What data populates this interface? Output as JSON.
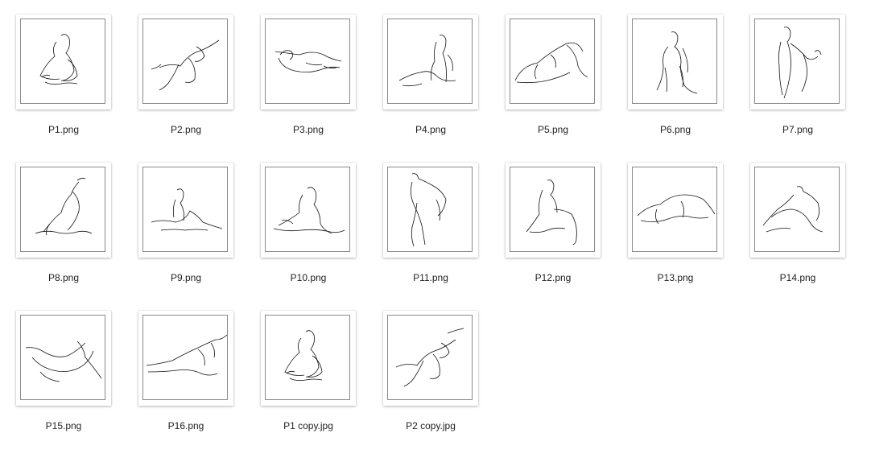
{
  "files": [
    {
      "name": "P1.png"
    },
    {
      "name": "P2.png"
    },
    {
      "name": "P3.png"
    },
    {
      "name": "P4.png"
    },
    {
      "name": "P5.png"
    },
    {
      "name": "P6.png"
    },
    {
      "name": "P7.png"
    },
    {
      "name": "P8.png"
    },
    {
      "name": "P9.png"
    },
    {
      "name": "P10.png"
    },
    {
      "name": "P11.png"
    },
    {
      "name": "P12.png"
    },
    {
      "name": "P13.png"
    },
    {
      "name": "P14.png"
    },
    {
      "name": "P15.png"
    },
    {
      "name": "P16.png"
    },
    {
      "name": "P1 copy.jpg"
    },
    {
      "name": "P2 copy.jpg"
    }
  ]
}
